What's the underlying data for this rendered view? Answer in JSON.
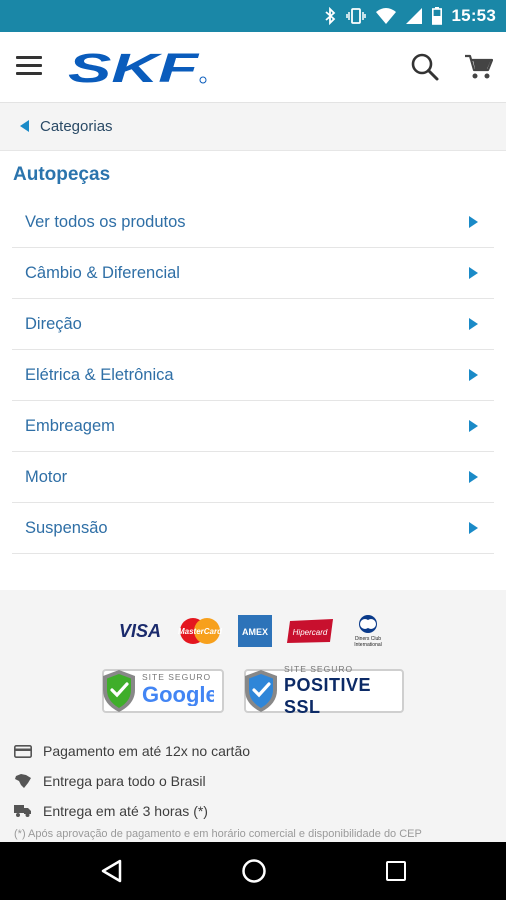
{
  "status_bar": {
    "time": "15:53",
    "icons": [
      "bluetooth-icon",
      "vibrate-icon",
      "wifi-icon",
      "signal-icon",
      "battery-icon"
    ]
  },
  "app_bar": {
    "logo_text": "SKF",
    "icons": [
      "menu-icon",
      "search-icon",
      "cart-icon"
    ]
  },
  "breadcrumb": {
    "label": "Categorias"
  },
  "category": {
    "title": "Autopeças",
    "items": [
      {
        "label": "Ver todos os produtos"
      },
      {
        "label": "Câmbio & Diferencial"
      },
      {
        "label": "Direção"
      },
      {
        "label": "Elétrica & Eletrônica"
      },
      {
        "label": "Embreagem"
      },
      {
        "label": "Motor"
      },
      {
        "label": "Suspensão"
      }
    ]
  },
  "footer": {
    "payment_logos": {
      "visa": "VISA",
      "mastercard": "MasterCard",
      "amex": "AMEX",
      "hipercard": "Hipercard",
      "diners_1": "Diners Club",
      "diners_2": "International"
    },
    "seals": {
      "google_small": "SITE SEGURO",
      "google_big": "Google",
      "ssl_small": "SITE SEGURO",
      "ssl_big": "POSITIVE SSL"
    },
    "features": [
      {
        "icon": "credit-card-icon",
        "text": "Pagamento em até 12x no cartão"
      },
      {
        "icon": "brazil-map-icon",
        "text": "Entrega para todo o Brasil"
      },
      {
        "icon": "delivery-truck-icon",
        "text": "Entrega em até 3 horas (*)"
      }
    ],
    "footnote": "(*) Após aprovação de pagamento e em horário comercial e disponibilidade do CEP"
  },
  "colors": {
    "status_bar": "#1a87a7",
    "accent": "#1a8ac7",
    "title": "#2b74ad",
    "link": "#2f6fa6",
    "skf_blue": "#0a5cbc"
  },
  "nav_bar": {
    "icons": [
      "nav-back-icon",
      "nav-home-icon",
      "nav-recents-icon"
    ]
  }
}
